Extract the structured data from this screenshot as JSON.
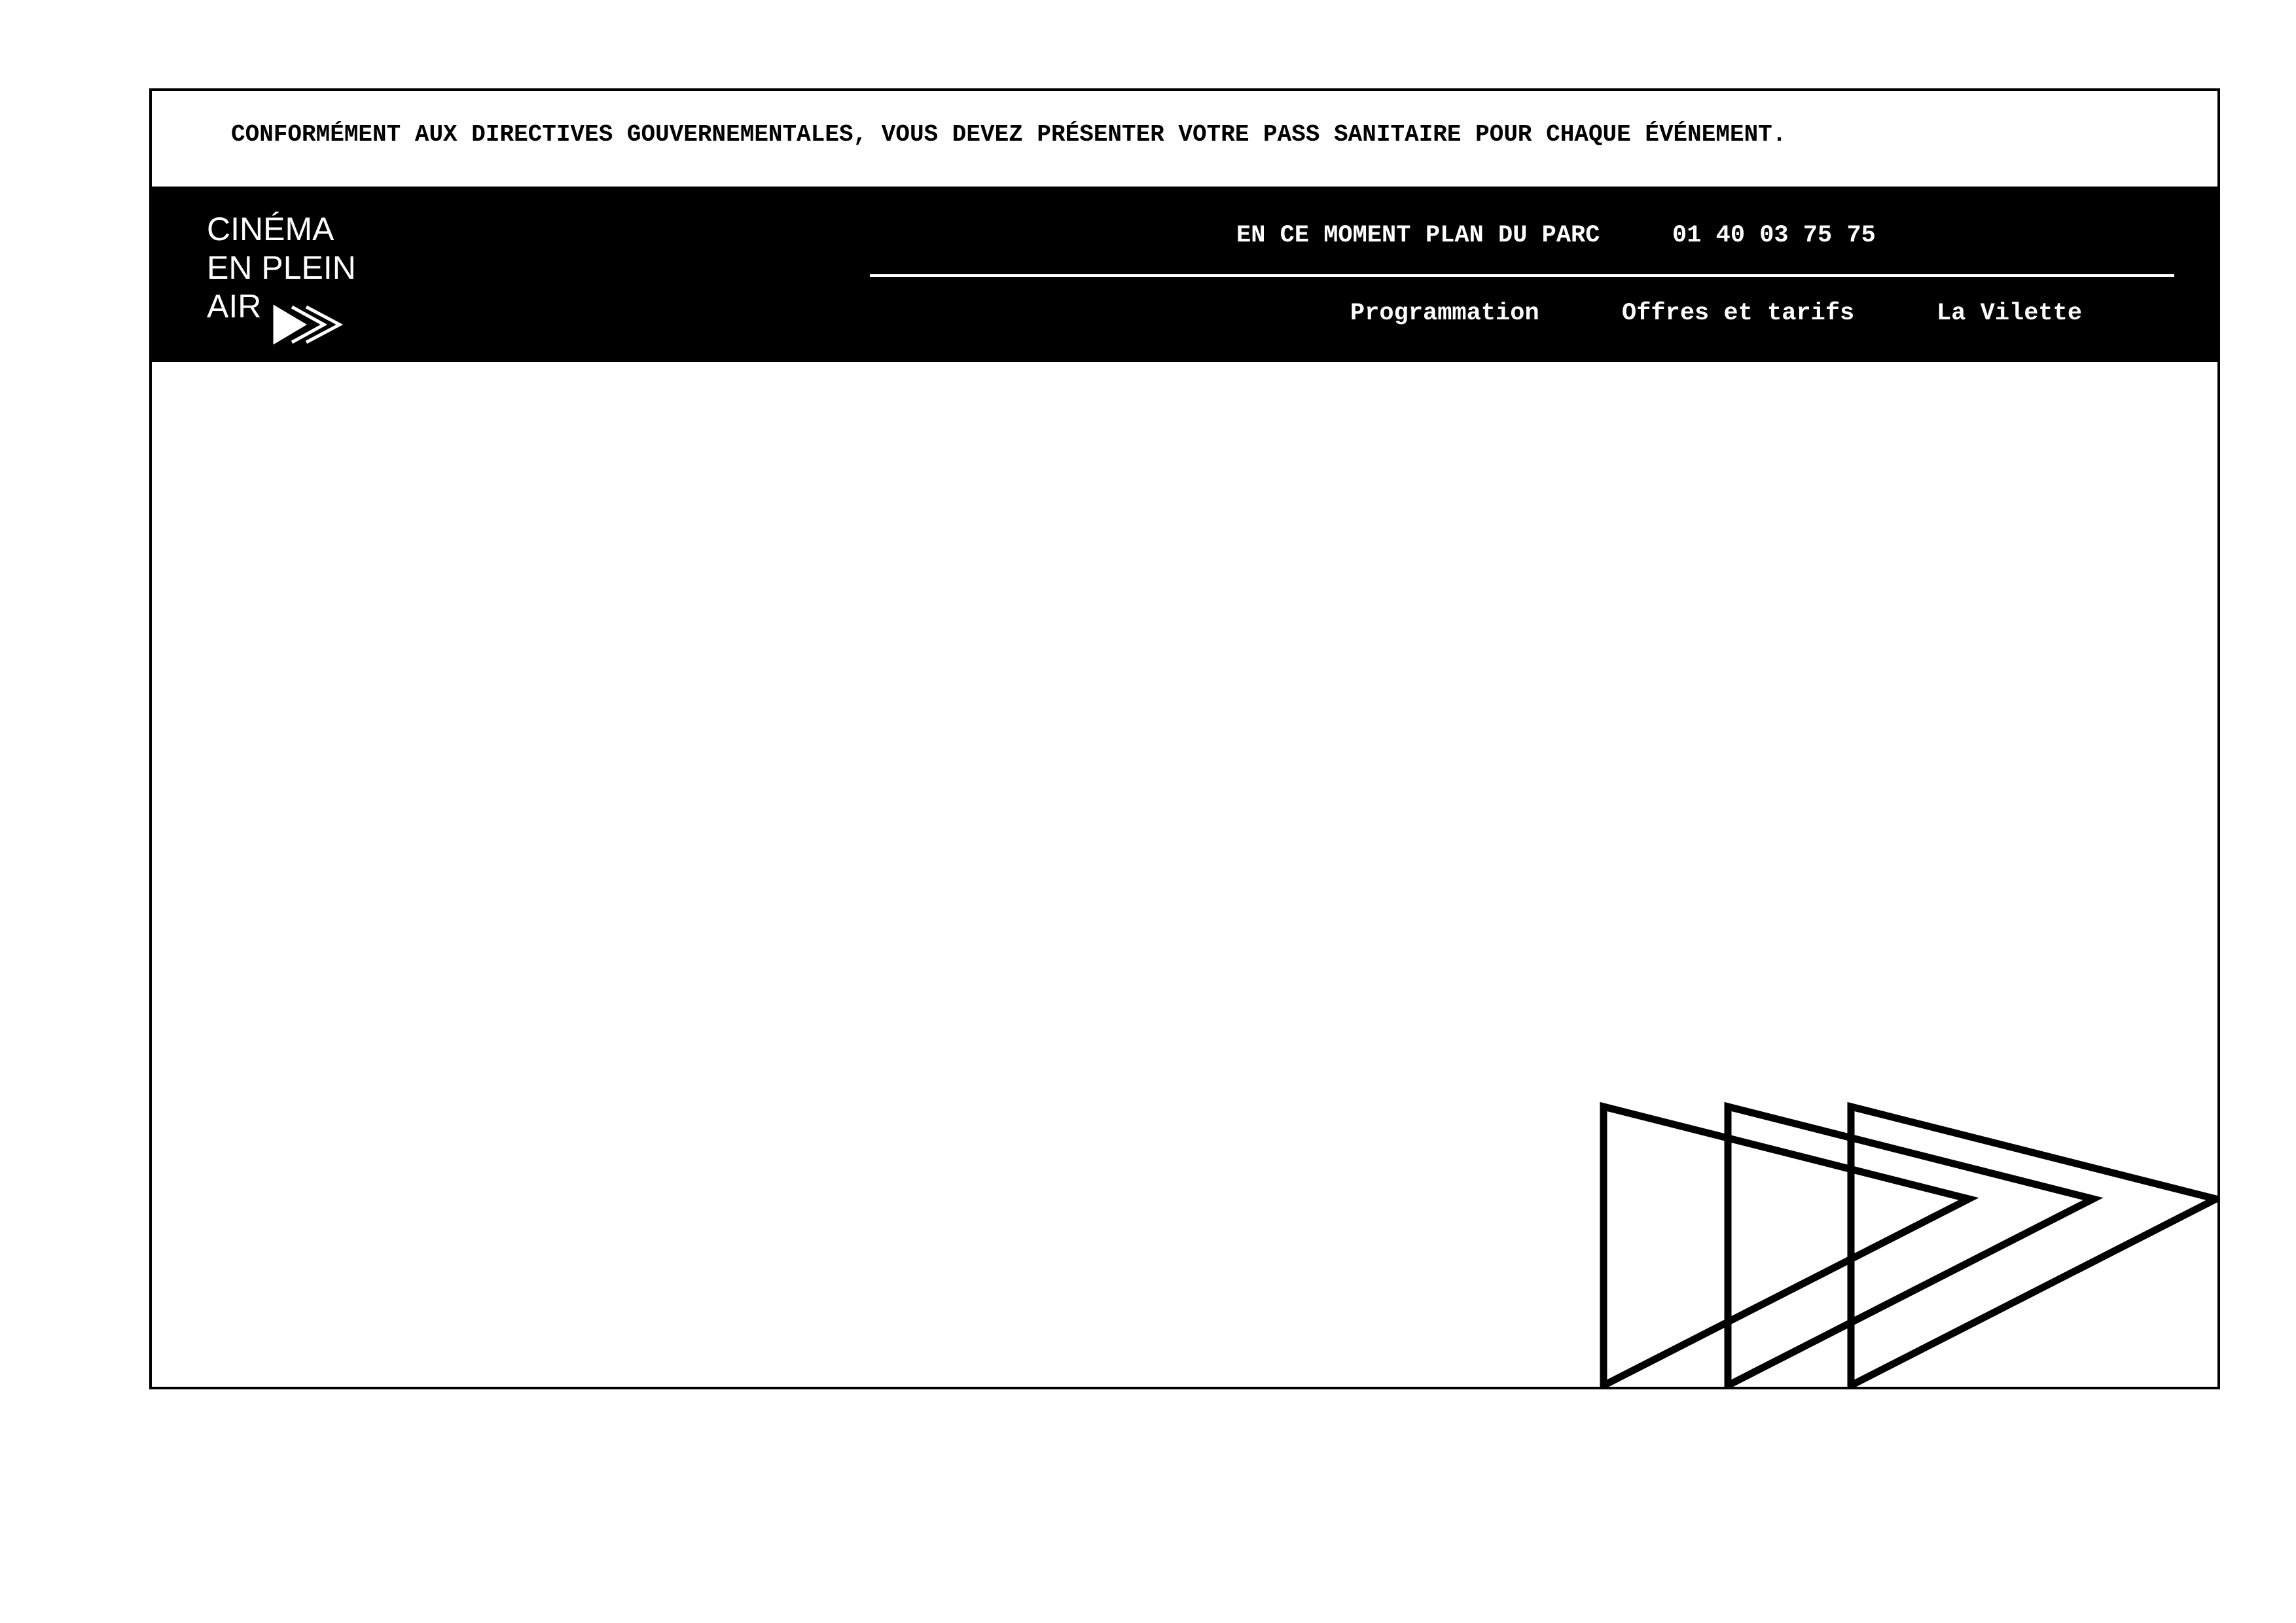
{
  "notice": {
    "text": "CONFORMÉMENT AUX DIRECTIVES GOUVERNEMENTALES, VOUS DEVEZ PRÉSENTER VOTRE PASS SANITAIRE POUR CHAQUE ÉVÉNEMENT."
  },
  "header": {
    "logo": {
      "line1": "CINÉMA",
      "line2": "EN PLEIN",
      "line3": "AIR",
      "icon": "triple-play-arrows-icon"
    },
    "top_nav": {
      "en_ce_moment": "EN CE MOMENT",
      "plan_du_parc": "PLAN DU PARC",
      "phone": "01 40 03 75 75"
    },
    "main_nav": {
      "programmation": "Programmation",
      "offres": "Offres et tarifs",
      "villette": "La Vilette"
    }
  },
  "decoration": {
    "icon": "triple-triangle-outline-icon"
  },
  "colors": {
    "background": "#ffffff",
    "header": "#000000",
    "text_on_dark": "#ffffff",
    "text_on_light": "#000000"
  }
}
